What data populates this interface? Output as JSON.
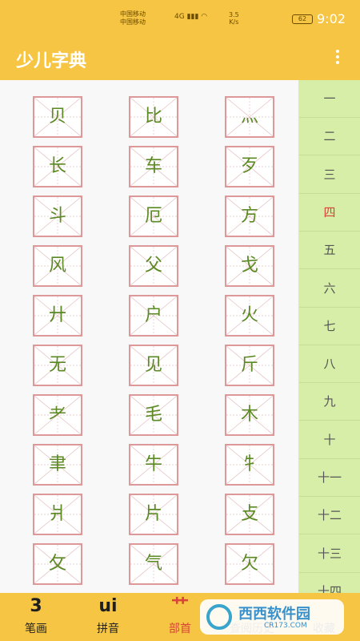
{
  "status": {
    "carrier1": "中国移动",
    "carrier2": "中国移动",
    "network": "4G",
    "speed": "3.5",
    "speed_unit": "K/s",
    "battery": "62",
    "time": "9:02"
  },
  "app": {
    "title": "少儿字典"
  },
  "characters": [
    "贝",
    "比",
    "灬",
    "长",
    "车",
    "歹",
    "斗",
    "厄",
    "方",
    "风",
    "父",
    "戈",
    "廾",
    "户",
    "火",
    "无",
    "见",
    "斤",
    "耂",
    "毛",
    "木",
    "聿",
    "牛",
    "牜",
    "爿",
    "片",
    "攴",
    "攵",
    "气",
    "欠"
  ],
  "stroke_index": [
    "一",
    "二",
    "三",
    "四",
    "五",
    "六",
    "七",
    "八",
    "九",
    "十",
    "十一",
    "十二",
    "十三",
    "十四"
  ],
  "active_stroke": "四",
  "tabs": [
    {
      "big": "3",
      "label": "笔画"
    },
    {
      "big": "ui",
      "label": "拼音"
    },
    {
      "big": "艹",
      "label": "部首"
    },
    {
      "big": "",
      "label": "查阅历史"
    },
    {
      "big": "",
      "label": "收藏"
    }
  ],
  "watermark": {
    "text": "西西软件园",
    "sub": "CR173.COM"
  }
}
